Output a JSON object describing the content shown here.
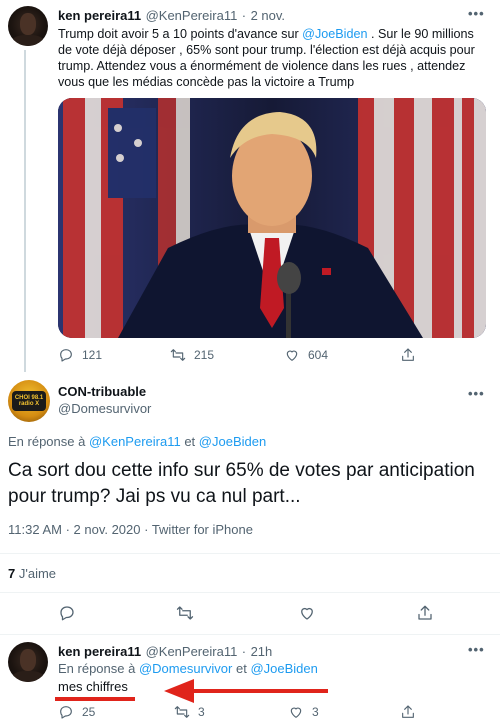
{
  "tweet1": {
    "name": "ken pereira11",
    "handle": "@KenPereira11",
    "sep": "·",
    "date": "2 nov.",
    "more": "•••",
    "text_pre": "Trump doit avoir 5 a 10 points d'avance sur ",
    "mention": "@JoeBiden",
    "text_post": " . Sur le 90 millions de vote déjà déposer , 65% sont pour trump. l'élection est déjà acquis pour trump. Attendez vous a énormément de violence dans les rues , attendez vous que les médias concède pas la victoire a Trump",
    "replies": "121",
    "retweets": "215",
    "likes": "604"
  },
  "tweet2": {
    "avatar_text": "CHOI 98.1 radio X",
    "name": "CON-tribuable",
    "handle": "@Domesurvivor",
    "more": "•••",
    "reply_prefix": "En réponse à",
    "reply_to_1": "@KenPereira11",
    "reply_and": "et",
    "reply_to_2": "@JoeBiden",
    "text": "Ca sort dou cette info sur 65% de votes par anticipation pour trump? Jai ps vu ca nul part...",
    "time": "11:32 AM · 2 nov. 2020 · Twitter for iPhone",
    "likes_count": "7",
    "likes_label": "J'aime"
  },
  "tweet3": {
    "name": "ken pereira11",
    "handle": "@KenPereira11",
    "sep": "·",
    "time": "21h",
    "more": "•••",
    "reply_prefix": "En réponse à",
    "reply_to_1": "@Domesurvivor",
    "reply_and": "et",
    "reply_to_2": "@JoeBiden",
    "text": "mes chiffres",
    "replies": "25",
    "retweets": "3",
    "likes": "3"
  },
  "colors": {
    "accent": "#1d9bf0",
    "annotation": "#e0241b",
    "muted": "#536471"
  },
  "icons": [
    "reply-icon",
    "retweet-icon",
    "like-icon",
    "share-icon",
    "more-icon"
  ]
}
